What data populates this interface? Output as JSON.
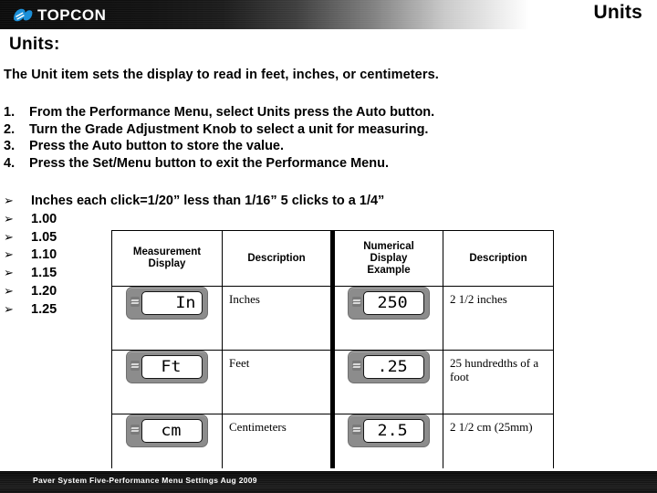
{
  "header": {
    "logo_text": "TOPCON",
    "logo_icon": "topcon-logo-mark",
    "title": "Units",
    "brand_blue": "#1b8fd8"
  },
  "slide": {
    "title": "Units:",
    "intro": "The Unit item sets the display to read in feet, inches, or centimeters.",
    "numbered_steps": [
      {
        "num": "1.",
        "text": "From the Performance Menu, select Units press the Auto button."
      },
      {
        "num": "2.",
        "text": "Turn the Grade Adjustment Knob to select a unit for measuring."
      },
      {
        "num": "3.",
        "text": "Press the Auto button to store the value."
      },
      {
        "num": "4.",
        "text": "Press the Set/Menu button to exit the Performance Menu."
      }
    ],
    "bullet_glyph": "➢",
    "bullets": [
      "Inches each click=1/20” less than 1/16” 5 clicks to a 1/4”",
      "1.00",
      "1.05",
      "1.10",
      "1.15",
      "1.20",
      "1.25"
    ]
  },
  "table": {
    "headers": [
      "Measurement Display",
      "Description",
      "Numerical Display Example",
      "Description"
    ],
    "header_lines": [
      [
        "Measurement",
        "Display"
      ],
      [
        "Description"
      ],
      [
        "Numerical",
        "Display",
        "Example"
      ],
      [
        "Description"
      ]
    ],
    "rows": [
      {
        "measurement_display": "In",
        "measurement_align": "right",
        "description": "Inches",
        "numerical_display": "250",
        "numerical_description": "2 1/2 inches"
      },
      {
        "measurement_display": "Ft",
        "measurement_align": "center",
        "description": "Feet",
        "numerical_display": ".25",
        "numerical_description": "25 hundredths of a foot"
      },
      {
        "measurement_display": "cm",
        "measurement_align": "center",
        "description": "Centimeters",
        "numerical_display": "2.5",
        "numerical_description": "2 1/2 cm (25mm)"
      }
    ]
  },
  "footer": {
    "text": "Paver System Five-Performance Menu Settings  Aug 2009"
  }
}
